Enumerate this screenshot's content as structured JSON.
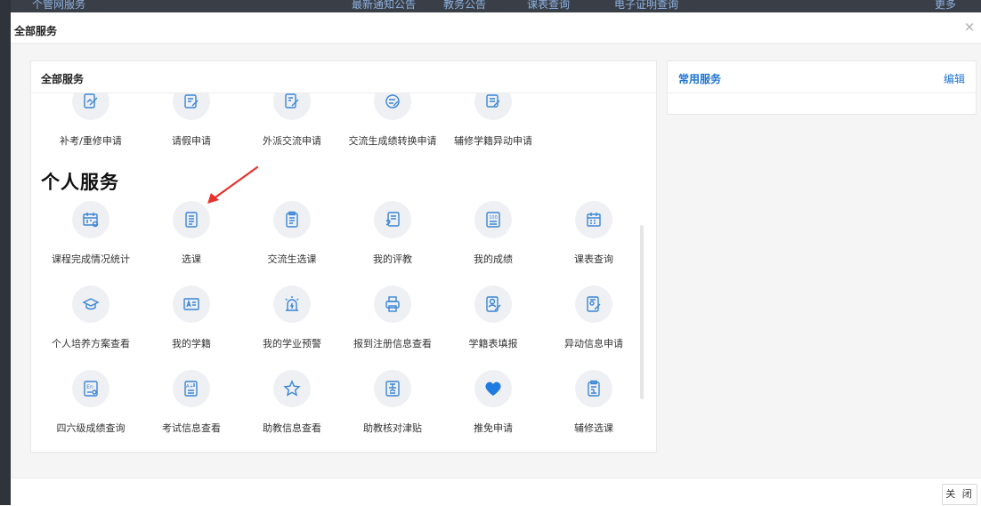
{
  "background": {
    "nav_items": [
      "个管网服务",
      "最新通知公告",
      "教务公告",
      "课表查询",
      "电子证明查询",
      "更多"
    ]
  },
  "modal": {
    "title": "全部服务",
    "close_label": "×",
    "footer_close": "关 闭"
  },
  "all_services": {
    "title": "全部服务",
    "top_row": [
      {
        "label": "补考/重修申请",
        "icon": "pencil-form-icon"
      },
      {
        "label": "请假申请",
        "icon": "doc-edit-icon"
      },
      {
        "label": "外派交流申请",
        "icon": "form-pen-icon"
      },
      {
        "label": "交流生成绩转换申请",
        "icon": "swap-edit-icon"
      },
      {
        "label": "辅修学籍异动申请",
        "icon": "card-edit-icon"
      }
    ],
    "section_title": "个人服务",
    "personal": [
      {
        "label": "课程完成情况统计",
        "icon": "calendar-search-icon"
      },
      {
        "label": "选课",
        "icon": "document-lines-icon"
      },
      {
        "label": "交流生选课",
        "icon": "clipboard-icon"
      },
      {
        "label": "我的评教",
        "icon": "rate-doc-icon"
      },
      {
        "label": "我的成绩",
        "icon": "score-100-icon"
      },
      {
        "label": "课表查询",
        "icon": "timetable-icon"
      },
      {
        "label": "个人培养方案查看",
        "icon": "graduation-cap-icon"
      },
      {
        "label": "我的学籍",
        "icon": "id-card-icon"
      },
      {
        "label": "我的学业预警",
        "icon": "alarm-light-icon"
      },
      {
        "label": "报到注册信息查看",
        "icon": "printer-icon"
      },
      {
        "label": "学籍表填报",
        "icon": "user-doc-icon"
      },
      {
        "label": "异动信息申请",
        "icon": "change-edit-icon"
      },
      {
        "label": "四六级成绩查询",
        "icon": "english-doc-icon"
      },
      {
        "label": "考试信息查看",
        "icon": "exam-doc-icon"
      },
      {
        "label": "助教信息查看",
        "icon": "star-icon"
      },
      {
        "label": "助教核对津贴",
        "icon": "allowance-doc-icon"
      },
      {
        "label": "推免申请",
        "icon": "heart-icon"
      },
      {
        "label": "辅修选课",
        "icon": "minor-doc-icon"
      }
    ]
  },
  "common_services": {
    "title": "常用服务",
    "edit_label": "编辑"
  },
  "colors": {
    "accent": "#1e74d0",
    "icon_stroke": "#3b86d6",
    "icon_bg": "#eef0f3",
    "arrow": "#e8322b"
  }
}
